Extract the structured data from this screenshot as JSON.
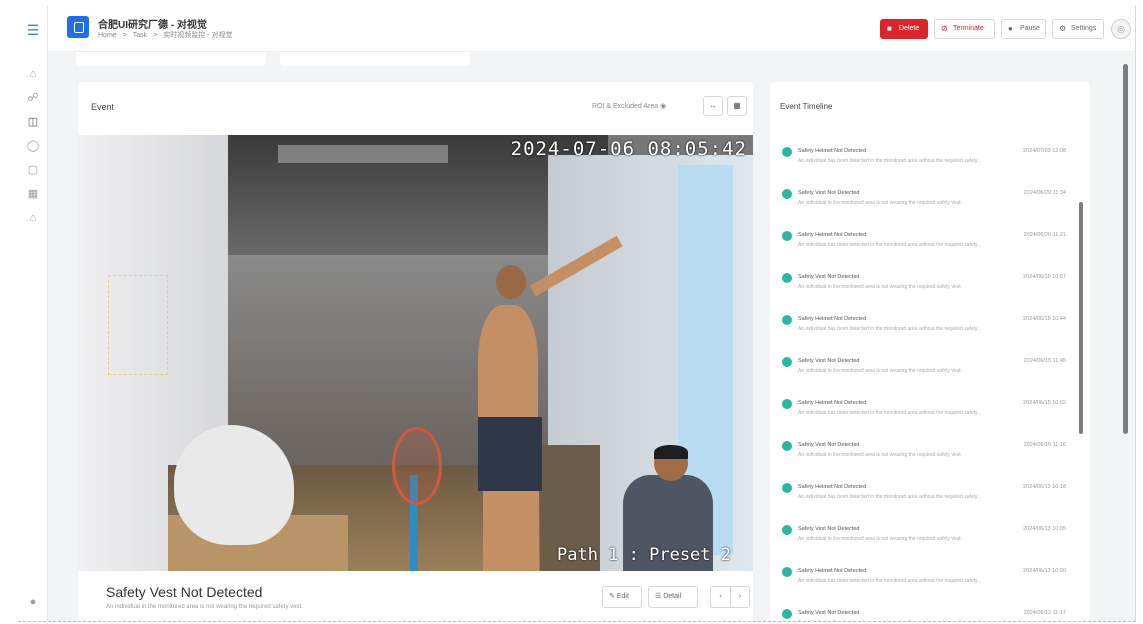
{
  "header": {
    "title": "合肥UI研究厂德 - 对视觉",
    "breadcrumbs": [
      "Home",
      ">",
      "Task",
      ">",
      "实时视频监控 - 对视觉"
    ]
  },
  "toolbar": {
    "delete_label": "Delete",
    "terminate_label": "Terminate",
    "pause_label": "Pause",
    "settings_label": "Settings"
  },
  "event": {
    "card_title": "Event",
    "roi_label": "ROI & Excluded Area",
    "timestamp": "2024-07-06 08:05:42",
    "preset": "Path 1 : Preset 2",
    "name": "Safety Vest Not Detected",
    "description": "An individual in the monitored area is not wearing the required safety vest.",
    "edit_label": "Edit",
    "detail_label": "Detail"
  },
  "timeline": {
    "title": "Event Timeline",
    "items": [
      {
        "name": "Safety Helmet Not Detected",
        "time": "2024/07/03 12:08",
        "desc": "An individual has been detected in the monitored area without the required safety..."
      },
      {
        "name": "Safety Vest Not Detected",
        "time": "2024/06/29 11:34",
        "desc": "An individual in the monitored area is not wearing the required safety vest."
      },
      {
        "name": "Safety Helmet Not Detected",
        "time": "2024/06/20 11:21",
        "desc": "An individual has been detected in the monitored area without the required safety..."
      },
      {
        "name": "Safety Vest Not Detected",
        "time": "2024/06/18 10:57",
        "desc": "An individual in the monitored area is not wearing the required safety vest."
      },
      {
        "name": "Safety Helmet Not Detected",
        "time": "2024/06/18 10:44",
        "desc": "An individual has been detected in the monitored area without the required safety..."
      },
      {
        "name": "Safety Vest Not Detected",
        "time": "2024/06/15 11:45",
        "desc": "An individual in the monitored area is not wearing the required safety vest."
      },
      {
        "name": "Safety Helmet Not Detected",
        "time": "2024/06/15 10:02",
        "desc": "An individual has been detected in the monitored area without the required safety..."
      },
      {
        "name": "Safety Vest Not Detected",
        "time": "2024/06/15 11:16",
        "desc": "An individual in the monitored area is not wearing the required safety vest."
      },
      {
        "name": "Safety Helmet Not Detected",
        "time": "2024/06/13 10:18",
        "desc": "An individual has been detected in the monitored area without the required safety..."
      },
      {
        "name": "Safety Vest Not Detected",
        "time": "2024/06/13 10:05",
        "desc": "An individual in the monitored area is not wearing the required safety vest."
      },
      {
        "name": "Safety Helmet Not Detected",
        "time": "2024/06/13 10:00",
        "desc": "An individual has been detected in the monitored area without the required safety..."
      },
      {
        "name": "Safety Vest Not Detected",
        "time": "2024/06/12 11:17",
        "desc": "An individual in the monitored area is not wearing the required safety vest."
      }
    ]
  },
  "colors": {
    "accent": "#1f6fe5",
    "danger": "#d9262c",
    "status_dot": "#2bb6a3"
  }
}
